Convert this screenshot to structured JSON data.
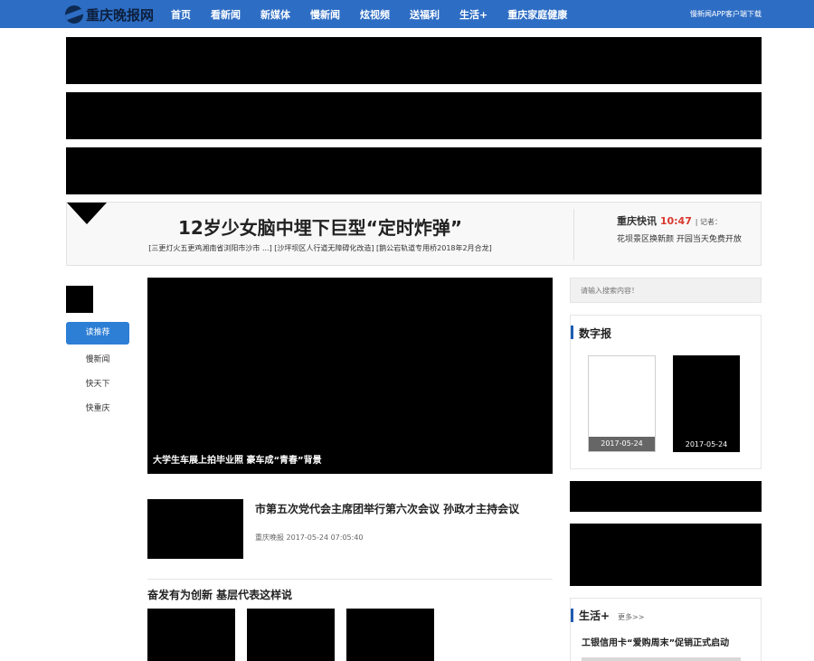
{
  "brand": {
    "logo_text": "重庆晚报网",
    "primary": "#2d6dc4",
    "accent_red": "#d9382c"
  },
  "nav": {
    "items": [
      "首页",
      "看新闻",
      "新媒体",
      "慢新闻",
      "炫视频",
      "送福利",
      "生活+",
      "重庆家庭健康"
    ],
    "app_download": "慢新闻APP客户端下载"
  },
  "headline": {
    "title": "12岁少女脑中埋下巨型“定时炸弹”",
    "sub_links": "[三更灯火五更鸡湘南省浏阳市沙市 ...] [沙坪坝区人行道无障碍化改造] [鹅公岩轨道专用桥2018年2月合龙]"
  },
  "kuaixun": {
    "label": "重庆快讯",
    "time": "10:47",
    "reporter": "| 记者：",
    "text": "花坝景区换新颜 开园当天免费开放"
  },
  "side_nav": {
    "active": "读推荐",
    "items": [
      "慢新闻",
      "快天下",
      "快重庆"
    ]
  },
  "hero": {
    "caption": "大学生车展上拍毕业照 豪车成“青春”背景"
  },
  "news": {
    "title": "市第五次党代会主席团举行第六次会议 孙政才主持会议",
    "meta": "重庆晚报 2017-05-24 07:05:40"
  },
  "section": {
    "title": "奋发有为创新 基层代表这样说"
  },
  "sidebar": {
    "search_placeholder": "请输入搜索内容！",
    "digital_title": "数字报",
    "papers": [
      {
        "date": "2017-05-24"
      },
      {
        "date": "2017-05-24"
      }
    ],
    "life_title": "生活+",
    "life_more": "更多>>",
    "life_headline": "工银信用卡“爱购周末”促销正式启动"
  }
}
